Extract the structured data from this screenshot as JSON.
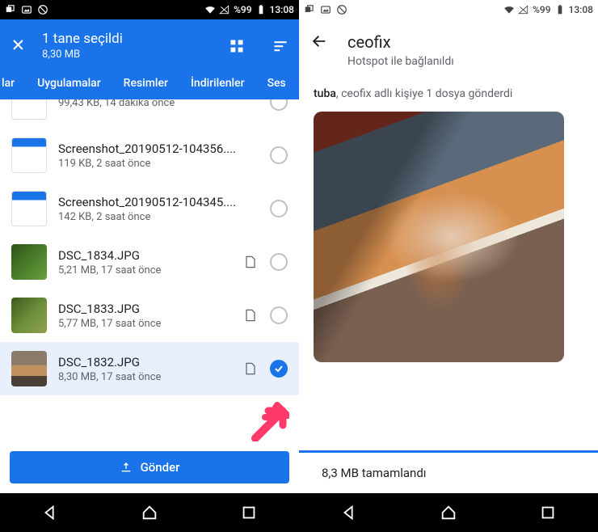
{
  "statusbar": {
    "battery_pct": "%99",
    "time": "13:08"
  },
  "left": {
    "header": {
      "title": "1 tane seçildi",
      "subtitle": "8,30 MB"
    },
    "tabs": [
      "lar",
      "Uygulamalar",
      "Resimler",
      "İndirilenler",
      "Ses"
    ],
    "files": [
      {
        "name": "",
        "meta": "99,43 KB, 14 dakika önce",
        "thumb": "docblue",
        "sd": false,
        "checked": false
      },
      {
        "name": "Screenshot_20190512-104356....",
        "meta": "119 KB, 2 saat önce",
        "thumb": "docblue",
        "sd": false,
        "checked": false
      },
      {
        "name": "Screenshot_20190512-104345....",
        "meta": "142 KB, 2 saat önce",
        "thumb": "docblue",
        "sd": false,
        "checked": false
      },
      {
        "name": "DSC_1834.JPG",
        "meta": "5,21 MB, 17 saat önce",
        "thumb": "green",
        "sd": true,
        "checked": false
      },
      {
        "name": "DSC_1833.JPG",
        "meta": "5,77 MB, 17 saat önce",
        "thumb": "green2",
        "sd": true,
        "checked": false
      },
      {
        "name": "DSC_1832.JPG",
        "meta": "8,30 MB, 17 saat önce",
        "thumb": "cat",
        "sd": true,
        "checked": true
      }
    ],
    "send_label": "Gönder"
  },
  "right": {
    "title": "ceofix",
    "subtitle": "Hotspot ile bağlanıldı",
    "sender": "tuba",
    "message_rest": ", ceofix adlı kişiye 1 dosya gönderdi",
    "status": "8,3 MB tamamlandı"
  }
}
